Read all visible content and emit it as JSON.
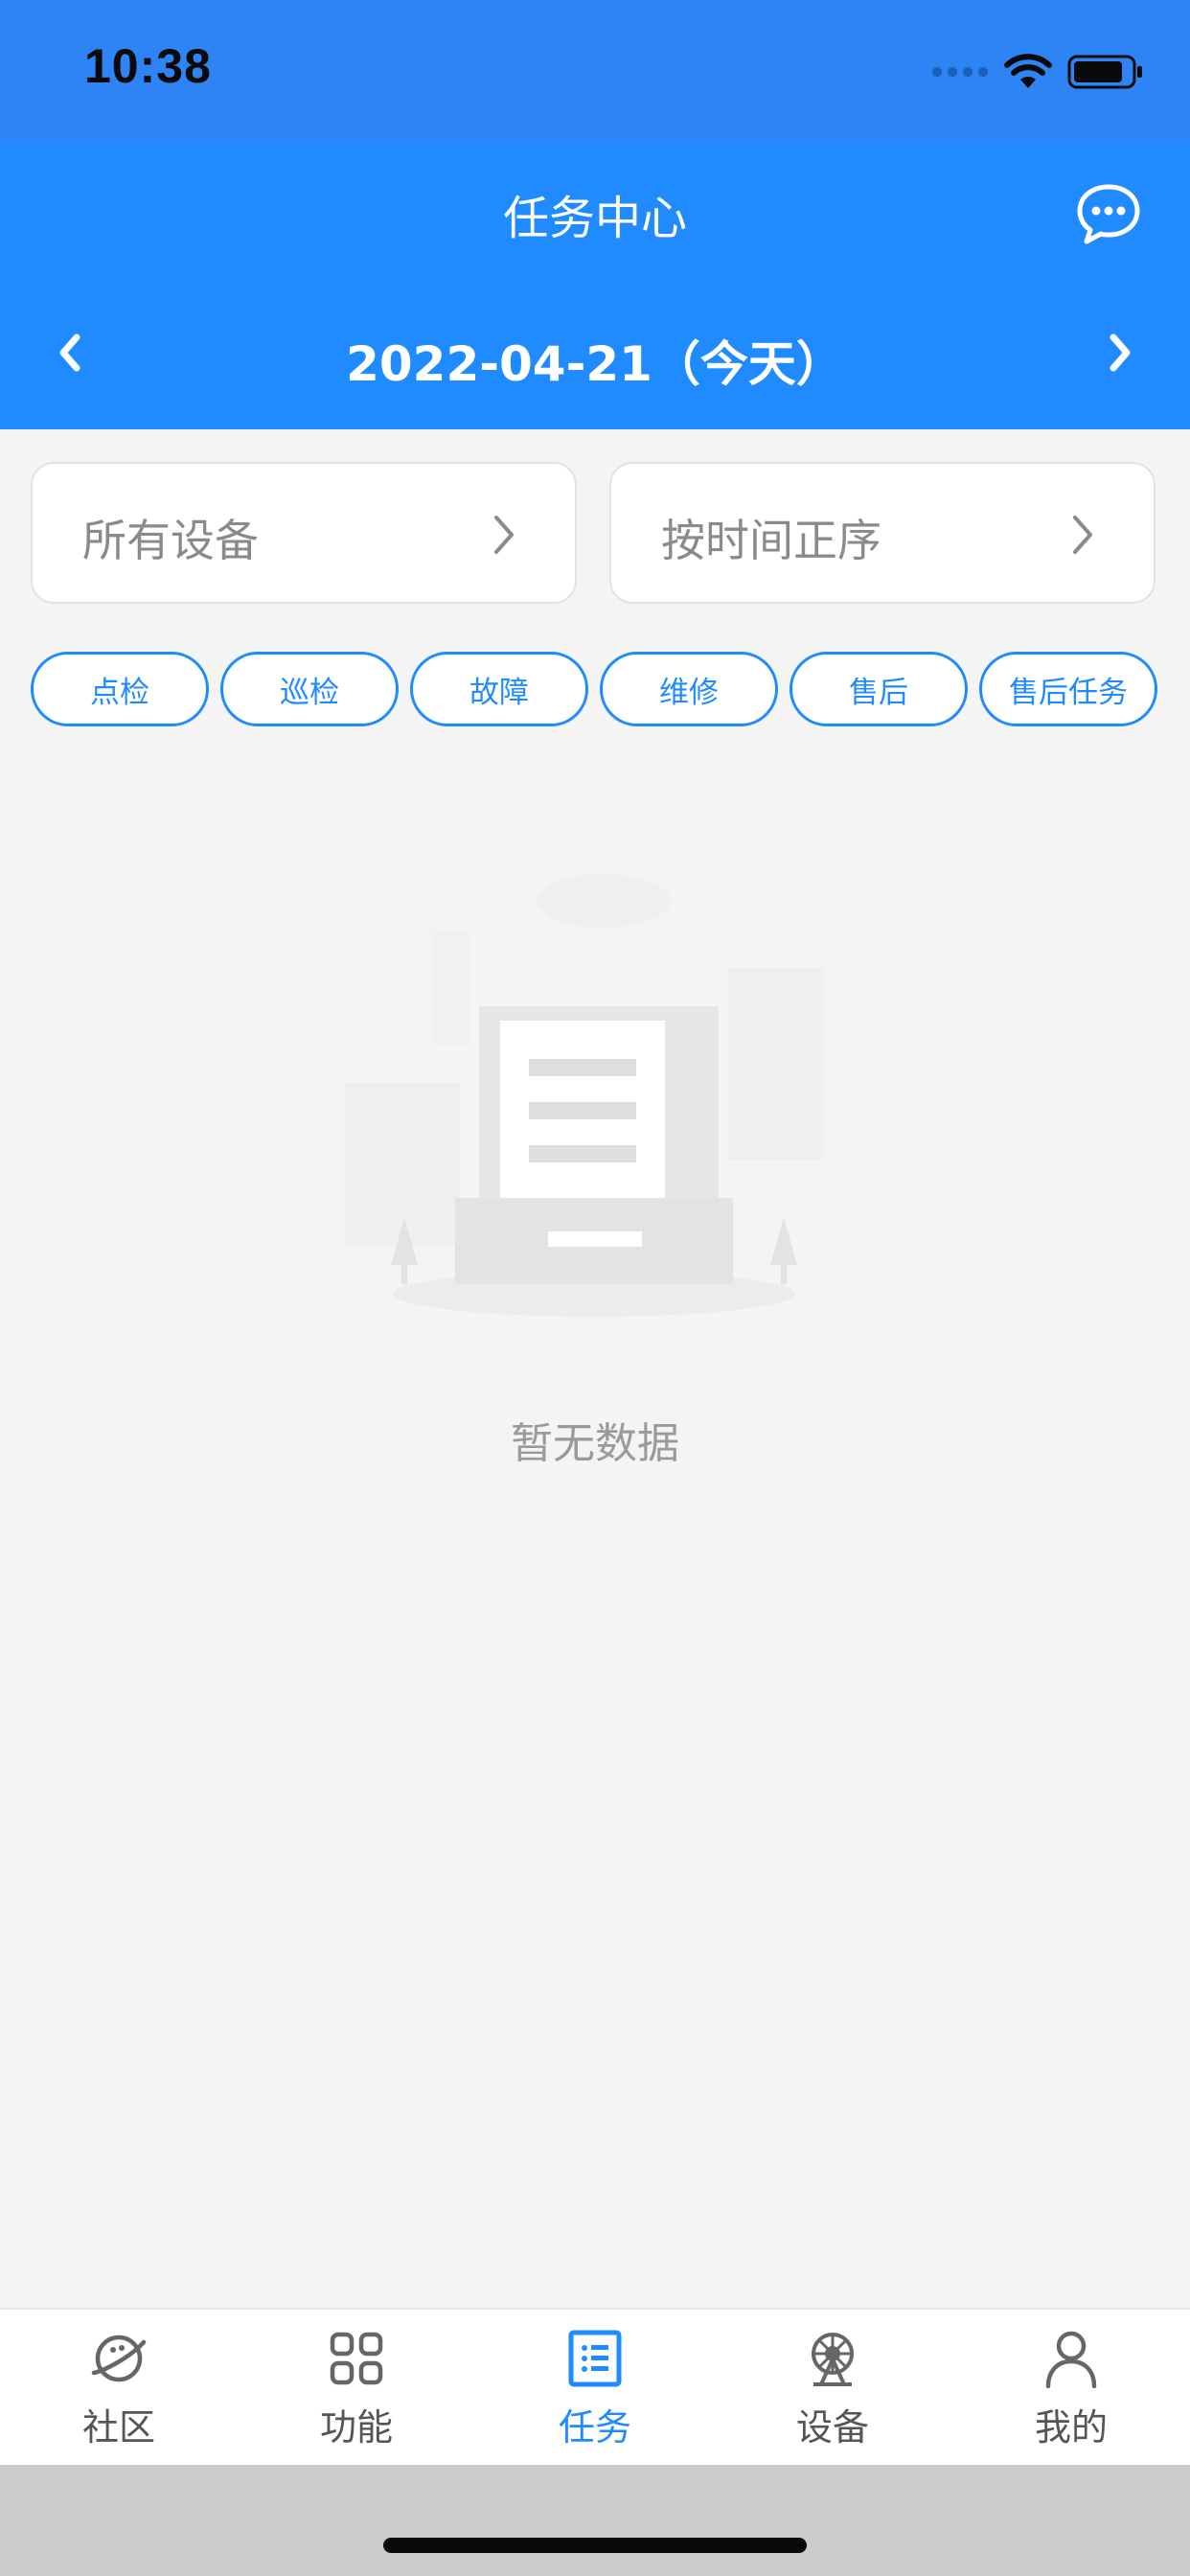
{
  "status_bar": {
    "time": "10:38",
    "icons": [
      "signal-icon",
      "wifi-icon",
      "battery-icon"
    ]
  },
  "header": {
    "title": "任务中心",
    "message_icon": "chat-bubble-icon",
    "date": "2022-04-21（今天）",
    "prev_icon": "chevron-left-icon",
    "next_icon": "chevron-right-icon"
  },
  "filters": {
    "device": "所有设备",
    "sort": "按时间正序"
  },
  "chips": [
    "点检",
    "巡检",
    "故障",
    "维修",
    "售后",
    "售后任务"
  ],
  "empty_state": {
    "text": "暂无数据",
    "icon": "empty-document-icon"
  },
  "tab_bar": {
    "active": "任务",
    "items": [
      {
        "label": "社区",
        "icon": "planet-icon"
      },
      {
        "label": "功能",
        "icon": "grid-icon"
      },
      {
        "label": "任务",
        "icon": "task-list-icon"
      },
      {
        "label": "设备",
        "icon": "ferris-wheel-icon"
      },
      {
        "label": "我的",
        "icon": "person-icon"
      }
    ]
  },
  "colors": {
    "status_bar_bg": "#2e84f5",
    "header_bg": "#1f8bff",
    "accent": "#1f8bff",
    "page_bg": "#f4f4f5"
  }
}
